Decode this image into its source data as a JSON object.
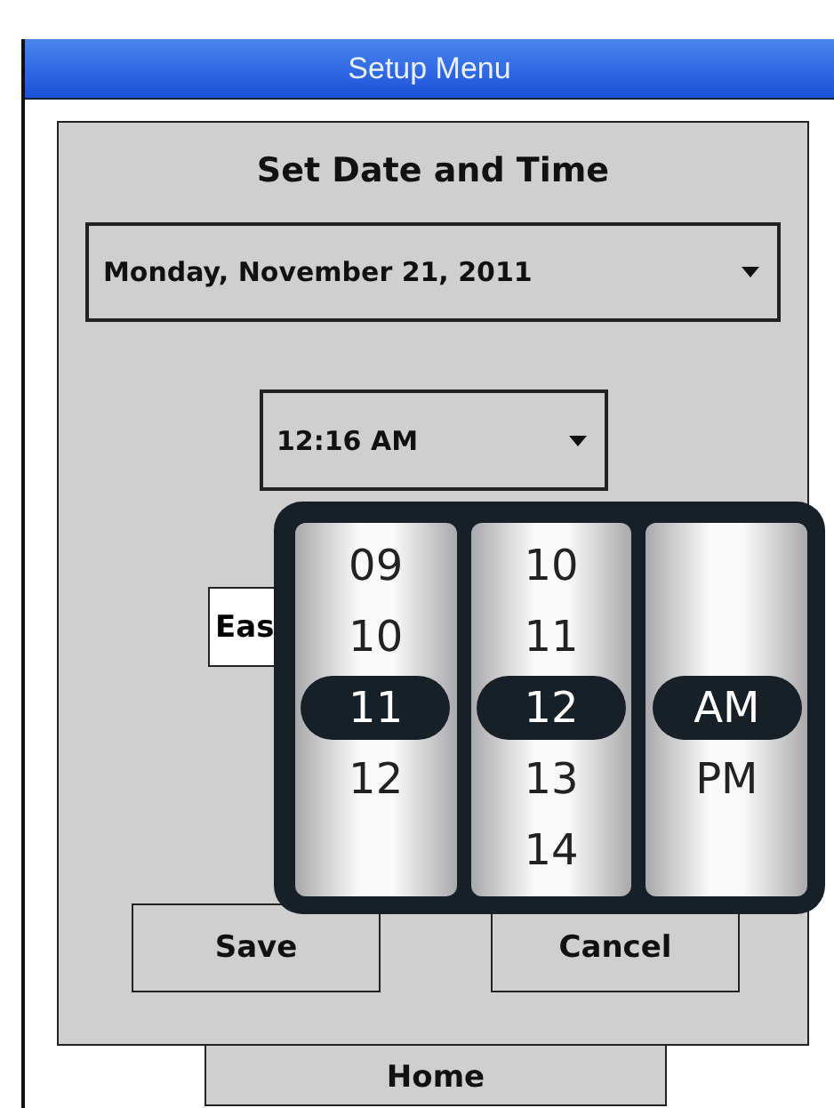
{
  "window": {
    "title": "Setup Menu"
  },
  "dialog": {
    "title": "Set Date and Time",
    "date": {
      "value": "Monday, November 21, 2011"
    },
    "time": {
      "value": "12:16 AM"
    },
    "timezone": {
      "value": "Eas"
    },
    "buttons": [
      "Save",
      "Cancel"
    ]
  },
  "picker": {
    "columns": [
      {
        "items": [
          {
            "label": "09",
            "selected": false
          },
          {
            "label": "10",
            "selected": false
          },
          {
            "label": "11",
            "selected": true
          },
          {
            "label": "12",
            "selected": false
          }
        ]
      },
      {
        "items": [
          {
            "label": "10",
            "selected": false
          },
          {
            "label": "11",
            "selected": false
          },
          {
            "label": "12",
            "selected": true
          },
          {
            "label": "13",
            "selected": false
          },
          {
            "label": "14",
            "selected": false
          }
        ]
      },
      {
        "items": [
          {
            "label": "AM",
            "selected": true
          },
          {
            "label": "PM",
            "selected": false
          }
        ]
      }
    ]
  },
  "home_button": "Home"
}
